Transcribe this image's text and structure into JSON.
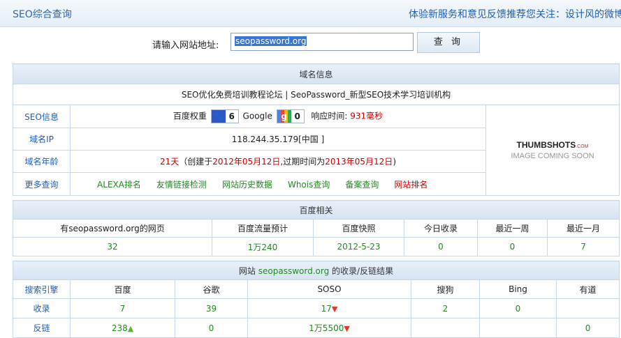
{
  "header": {
    "title": "SEO综合查询",
    "marquee": "体验新服务和意见反馈推荐您关注：设计风的微博"
  },
  "search": {
    "label": "请输入网站地址:",
    "value": "seopassword.org",
    "button": "查 询"
  },
  "domain_info": {
    "heading": "域名信息",
    "site_title": "SEO优化免费培训教程论坛 | SeoPassword_新型SEO技术学习培训机构",
    "seo_label": "SEO信息",
    "baidu_weight_label": "百度权重",
    "baidu_weight_value": "6",
    "google_label": "Google",
    "google_pr_value": "0",
    "response_label": "响应时间:",
    "response_value": "931毫秒",
    "ip_label": "域名IP",
    "ip_value": "118.244.35.179[中国 ]",
    "age_label": "域名年龄",
    "age_days": "21天",
    "age_open": "（创建于",
    "age_created": "2012年05月12日",
    "age_mid": ",过期时间为",
    "age_expire": "2013年05月12日",
    "age_close": ")",
    "more_label": "更多查询",
    "more_links": [
      "ALEXA排名",
      "友情链接检测",
      "网站历史数据",
      "Whois查询",
      "备案查询",
      "网站排名"
    ],
    "thumb_line1": "THUMBSHOTS",
    "thumb_com": ".COM",
    "thumb_line2": "IMAGE COMING SOON"
  },
  "baidu": {
    "heading": "百度相关",
    "columns": [
      "有seopassword.org的网页",
      "百度流量预计",
      "百度快照",
      "今日收录",
      "最近一周",
      "最近一月"
    ],
    "values": [
      "32",
      "1万240",
      "2012-5-23",
      "0",
      "0",
      "7"
    ]
  },
  "engines": {
    "heading_prefix": "网站",
    "heading_site": "seopassword.org",
    "heading_suffix": "的收录/反链结果",
    "columns": [
      "搜索引擎",
      "百度",
      "谷歌",
      "SOSO",
      "搜狗",
      "Bing",
      "有道"
    ],
    "row_index_label": "收录",
    "row_index": [
      "7",
      "39",
      "17",
      "2",
      "0",
      ""
    ],
    "row_back_label": "反链",
    "row_back": [
      "238",
      "0",
      "1万5500",
      "",
      "",
      "0"
    ]
  },
  "colors": {
    "link_blue": "#1f5fb7",
    "value_green": "#218a21",
    "alert_red": "#cc0000",
    "header_bg": "#d6e3f2"
  },
  "icons": {
    "baidu": "baidu-paw-icon",
    "google": "google-g-icon",
    "trend_up": "arrow-up-icon",
    "trend_down": "arrow-down-icon"
  }
}
